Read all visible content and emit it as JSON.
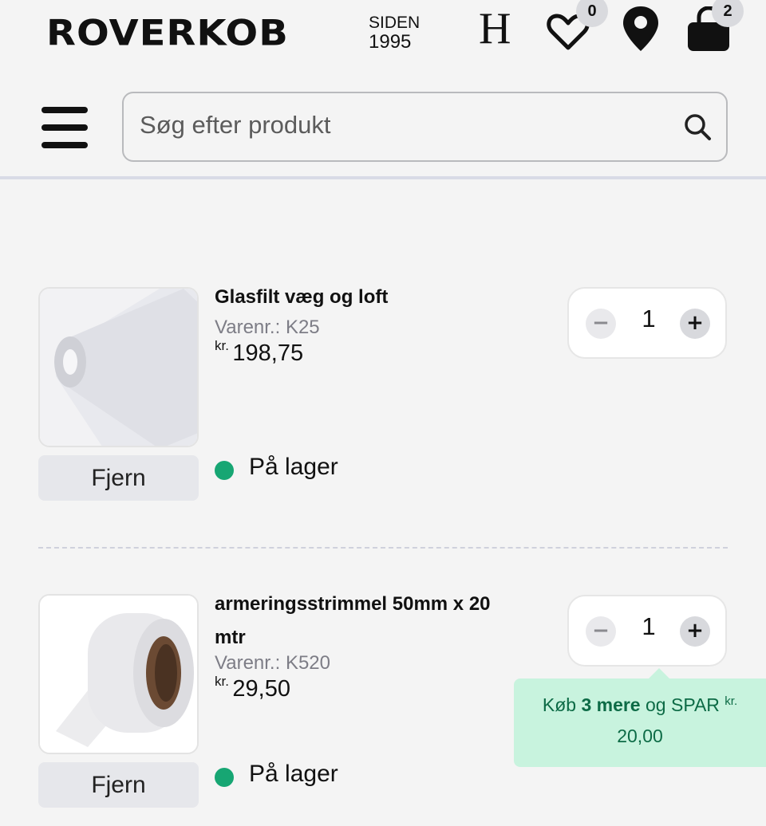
{
  "header": {
    "logo": "ROVERKOB",
    "since_label": "SIDEN",
    "since_year": "1995",
    "account_letter": "H",
    "wishlist_count": "0",
    "cart_count": "2"
  },
  "search": {
    "placeholder": "Søg efter produkt"
  },
  "cart": {
    "items": [
      {
        "name": "Glasfilt væg og loft",
        "sku_label": "Varenr.:",
        "sku": "K25",
        "currency": "kr.",
        "price": "198,75",
        "quantity": "1",
        "stock": "På lager",
        "remove_label": "Fjern"
      },
      {
        "name": "armeringsstrimmel 50mm x 20 mtr",
        "sku_label": "Varenr.:",
        "sku": "K520",
        "currency": "kr.",
        "price": "29,50",
        "quantity": "1",
        "stock": "På lager",
        "remove_label": "Fjern",
        "promo": {
          "prefix": "Køb",
          "highlight": "3 mere",
          "middle": "og SPAR",
          "currency": "kr.",
          "amount": "20,00"
        }
      }
    ]
  },
  "colors": {
    "stock_green": "#17a673",
    "promo_bg": "#c8f3de",
    "promo_text": "#0d6b46"
  }
}
